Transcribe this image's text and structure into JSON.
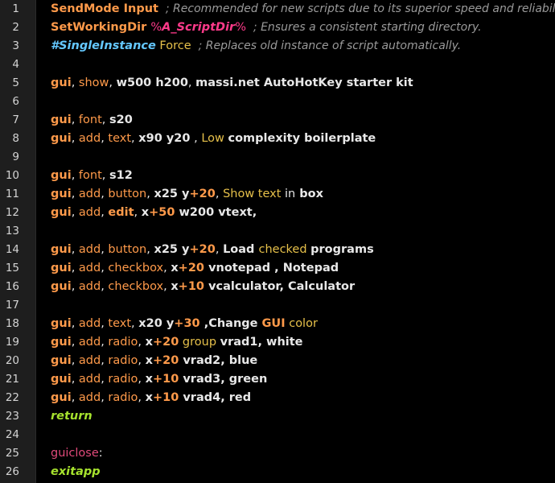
{
  "editor": {
    "lines": [
      {
        "n": "1",
        "tokens": [
          {
            "t": "SendMode Input",
            "c": "cmd"
          },
          {
            "t": "  ; Recommended for new scripts due to its superior speed and reliability.",
            "c": "cmt"
          }
        ]
      },
      {
        "n": "2",
        "tokens": [
          {
            "t": "SetWorkingDir ",
            "c": "cmd"
          },
          {
            "t": "%",
            "c": "pct"
          },
          {
            "t": "A_ScriptDir",
            "c": "var"
          },
          {
            "t": "%",
            "c": "pct"
          },
          {
            "t": "  ; Ensures a consistent starting directory.",
            "c": "cmt"
          }
        ]
      },
      {
        "n": "3",
        "tokens": [
          {
            "t": "#SingleInstance",
            "c": "dir"
          },
          {
            "t": " Force",
            "c": "txt"
          },
          {
            "t": "  ; Replaces old instance of script automatically.",
            "c": "cmt"
          }
        ]
      },
      {
        "n": "4",
        "tokens": []
      },
      {
        "n": "5",
        "tokens": [
          {
            "t": "gui",
            "c": "kw"
          },
          {
            "t": ", ",
            "c": "plain"
          },
          {
            "t": "show",
            "c": "sub"
          },
          {
            "t": ", ",
            "c": "plain"
          },
          {
            "t": "w500 h200",
            "c": "opt"
          },
          {
            "t": ", ",
            "c": "plain"
          },
          {
            "t": "massi.net AutoHotKey starter kit",
            "c": "bold"
          }
        ]
      },
      {
        "n": "6",
        "tokens": []
      },
      {
        "n": "7",
        "tokens": [
          {
            "t": "gui",
            "c": "kw"
          },
          {
            "t": ", ",
            "c": "plain"
          },
          {
            "t": "font",
            "c": "sub"
          },
          {
            "t": ", ",
            "c": "plain"
          },
          {
            "t": "s20",
            "c": "opt"
          }
        ]
      },
      {
        "n": "8",
        "tokens": [
          {
            "t": "gui",
            "c": "kw"
          },
          {
            "t": ", ",
            "c": "plain"
          },
          {
            "t": "add",
            "c": "sub"
          },
          {
            "t": ", ",
            "c": "plain"
          },
          {
            "t": "text",
            "c": "sub"
          },
          {
            "t": ", ",
            "c": "plain"
          },
          {
            "t": "x90 y20",
            "c": "opt"
          },
          {
            "t": " , ",
            "c": "plain"
          },
          {
            "t": "Low ",
            "c": "txt"
          },
          {
            "t": "complexity boilerplate",
            "c": "bold"
          }
        ]
      },
      {
        "n": "9",
        "tokens": []
      },
      {
        "n": "10",
        "tokens": [
          {
            "t": "gui",
            "c": "kw"
          },
          {
            "t": ", ",
            "c": "plain"
          },
          {
            "t": "font",
            "c": "sub"
          },
          {
            "t": ", ",
            "c": "plain"
          },
          {
            "t": "s12",
            "c": "opt"
          }
        ]
      },
      {
        "n": "11",
        "tokens": [
          {
            "t": "gui",
            "c": "kw"
          },
          {
            "t": ", ",
            "c": "plain"
          },
          {
            "t": "add",
            "c": "sub"
          },
          {
            "t": ", ",
            "c": "plain"
          },
          {
            "t": "button",
            "c": "sub"
          },
          {
            "t": ", ",
            "c": "plain"
          },
          {
            "t": "x25 y",
            "c": "opt"
          },
          {
            "t": "+",
            "c": "num"
          },
          {
            "t": "20",
            "c": "num"
          },
          {
            "t": ", ",
            "c": "plain"
          },
          {
            "t": "Show text ",
            "c": "txt"
          },
          {
            "t": "in",
            "c": "plain"
          },
          {
            "t": " box",
            "c": "bold"
          }
        ]
      },
      {
        "n": "12",
        "tokens": [
          {
            "t": "gui",
            "c": "kw"
          },
          {
            "t": ", ",
            "c": "plain"
          },
          {
            "t": "add",
            "c": "sub"
          },
          {
            "t": ", ",
            "c": "plain"
          },
          {
            "t": "edit",
            "c": "kw"
          },
          {
            "t": ", ",
            "c": "plain"
          },
          {
            "t": "x",
            "c": "opt"
          },
          {
            "t": "+",
            "c": "num"
          },
          {
            "t": "50",
            "c": "num"
          },
          {
            "t": " w200 vtext,",
            "c": "opt"
          }
        ]
      },
      {
        "n": "13",
        "tokens": []
      },
      {
        "n": "14",
        "tokens": [
          {
            "t": "gui",
            "c": "kw"
          },
          {
            "t": ", ",
            "c": "plain"
          },
          {
            "t": "add",
            "c": "sub"
          },
          {
            "t": ", ",
            "c": "plain"
          },
          {
            "t": "button",
            "c": "sub"
          },
          {
            "t": ", ",
            "c": "plain"
          },
          {
            "t": "x25 y",
            "c": "opt"
          },
          {
            "t": "+",
            "c": "num"
          },
          {
            "t": "20",
            "c": "num"
          },
          {
            "t": ", ",
            "c": "plain"
          },
          {
            "t": "Load ",
            "c": "bold"
          },
          {
            "t": "checked ",
            "c": "txt"
          },
          {
            "t": "programs",
            "c": "bold"
          }
        ]
      },
      {
        "n": "15",
        "tokens": [
          {
            "t": "gui",
            "c": "kw"
          },
          {
            "t": ", ",
            "c": "plain"
          },
          {
            "t": "add",
            "c": "sub"
          },
          {
            "t": ", ",
            "c": "plain"
          },
          {
            "t": "checkbox",
            "c": "sub"
          },
          {
            "t": ", ",
            "c": "plain"
          },
          {
            "t": "x",
            "c": "opt"
          },
          {
            "t": "+",
            "c": "num"
          },
          {
            "t": "20",
            "c": "num"
          },
          {
            "t": " vnotepad , Notepad",
            "c": "opt"
          }
        ]
      },
      {
        "n": "16",
        "tokens": [
          {
            "t": "gui",
            "c": "kw"
          },
          {
            "t": ", ",
            "c": "plain"
          },
          {
            "t": "add",
            "c": "sub"
          },
          {
            "t": ", ",
            "c": "plain"
          },
          {
            "t": "checkbox",
            "c": "sub"
          },
          {
            "t": ", ",
            "c": "plain"
          },
          {
            "t": "x",
            "c": "opt"
          },
          {
            "t": "+",
            "c": "num"
          },
          {
            "t": "10",
            "c": "num"
          },
          {
            "t": " vcalculator, Calculator",
            "c": "opt"
          }
        ]
      },
      {
        "n": "17",
        "tokens": []
      },
      {
        "n": "18",
        "tokens": [
          {
            "t": "gui",
            "c": "kw"
          },
          {
            "t": ", ",
            "c": "plain"
          },
          {
            "t": "add",
            "c": "sub"
          },
          {
            "t": ", ",
            "c": "plain"
          },
          {
            "t": "text",
            "c": "sub"
          },
          {
            "t": ", ",
            "c": "plain"
          },
          {
            "t": "x20 y",
            "c": "opt"
          },
          {
            "t": "+",
            "c": "num"
          },
          {
            "t": "30",
            "c": "num"
          },
          {
            "t": " ,Change ",
            "c": "opt"
          },
          {
            "t": "GUI",
            "c": "kw"
          },
          {
            "t": " color",
            "c": "txt"
          }
        ]
      },
      {
        "n": "19",
        "tokens": [
          {
            "t": "gui",
            "c": "kw"
          },
          {
            "t": ", ",
            "c": "plain"
          },
          {
            "t": "add",
            "c": "sub"
          },
          {
            "t": ", ",
            "c": "plain"
          },
          {
            "t": "radio",
            "c": "sub"
          },
          {
            "t": ", ",
            "c": "plain"
          },
          {
            "t": "x",
            "c": "opt"
          },
          {
            "t": "+",
            "c": "num"
          },
          {
            "t": "20",
            "c": "num"
          },
          {
            "t": " group ",
            "c": "txt"
          },
          {
            "t": "vrad1, white",
            "c": "opt"
          }
        ]
      },
      {
        "n": "20",
        "tokens": [
          {
            "t": "gui",
            "c": "kw"
          },
          {
            "t": ", ",
            "c": "plain"
          },
          {
            "t": "add",
            "c": "sub"
          },
          {
            "t": ", ",
            "c": "plain"
          },
          {
            "t": "radio",
            "c": "sub"
          },
          {
            "t": ", ",
            "c": "plain"
          },
          {
            "t": "x",
            "c": "opt"
          },
          {
            "t": "+",
            "c": "num"
          },
          {
            "t": "20",
            "c": "num"
          },
          {
            "t": " vrad2, blue",
            "c": "opt"
          }
        ]
      },
      {
        "n": "21",
        "tokens": [
          {
            "t": "gui",
            "c": "kw"
          },
          {
            "t": ", ",
            "c": "plain"
          },
          {
            "t": "add",
            "c": "sub"
          },
          {
            "t": ", ",
            "c": "plain"
          },
          {
            "t": "radio",
            "c": "sub"
          },
          {
            "t": ", ",
            "c": "plain"
          },
          {
            "t": "x",
            "c": "opt"
          },
          {
            "t": "+",
            "c": "num"
          },
          {
            "t": "10",
            "c": "num"
          },
          {
            "t": " vrad3, green",
            "c": "opt"
          }
        ]
      },
      {
        "n": "22",
        "tokens": [
          {
            "t": "gui",
            "c": "kw"
          },
          {
            "t": ", ",
            "c": "plain"
          },
          {
            "t": "add",
            "c": "sub"
          },
          {
            "t": ", ",
            "c": "plain"
          },
          {
            "t": "radio",
            "c": "sub"
          },
          {
            "t": ", ",
            "c": "plain"
          },
          {
            "t": "x",
            "c": "opt"
          },
          {
            "t": "+",
            "c": "num"
          },
          {
            "t": "10",
            "c": "num"
          },
          {
            "t": " vrad4, red",
            "c": "opt"
          }
        ]
      },
      {
        "n": "23",
        "tokens": [
          {
            "t": "return",
            "c": "ctl"
          }
        ]
      },
      {
        "n": "24",
        "tokens": []
      },
      {
        "n": "25",
        "tokens": [
          {
            "t": "guiclose",
            "c": "lbl"
          },
          {
            "t": ":",
            "c": "plain"
          }
        ]
      },
      {
        "n": "26",
        "tokens": [
          {
            "t": "exitapp",
            "c": "ctl"
          }
        ]
      }
    ]
  }
}
